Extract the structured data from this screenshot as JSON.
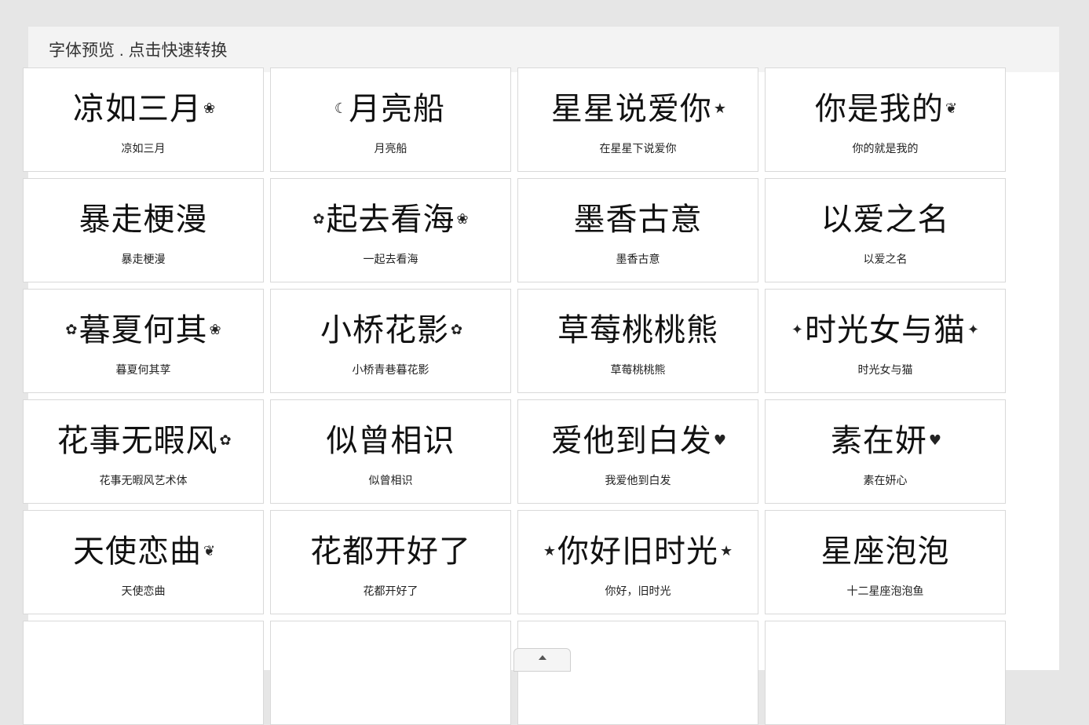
{
  "panel": {
    "title": "字体预览 . 点击快速转换"
  },
  "fonts": [
    {
      "preview": "凉如三月",
      "caption": "凉如三月",
      "deco_left": "",
      "deco_right": "❀"
    },
    {
      "preview": "月亮船",
      "caption": "月亮船",
      "deco_left": "☾",
      "deco_right": ""
    },
    {
      "preview": "星星说爱你",
      "caption": "在星星下说爱你",
      "deco_left": "",
      "deco_right": "★"
    },
    {
      "preview": "你是我的",
      "caption": "你的就是我的",
      "deco_left": "",
      "deco_right": "❦"
    },
    {
      "preview": "暴走梗漫",
      "caption": "暴走梗漫",
      "deco_left": "",
      "deco_right": ""
    },
    {
      "preview": "起去看海",
      "caption": "一起去看海",
      "deco_left": "✿",
      "deco_right": "❀"
    },
    {
      "preview": "墨香古意",
      "caption": "墨香古意",
      "deco_left": "",
      "deco_right": ""
    },
    {
      "preview": "以爱之名",
      "caption": "以爱之名",
      "deco_left": "",
      "deco_right": ""
    },
    {
      "preview": "暮夏何其",
      "caption": "暮夏何其莩",
      "deco_left": "✿",
      "deco_right": "❀"
    },
    {
      "preview": "小桥花影",
      "caption": "小桥青巷暮花影",
      "deco_left": "",
      "deco_right": "✿"
    },
    {
      "preview": "草莓桃桃熊",
      "caption": "草莓桃桃熊",
      "deco_left": "",
      "deco_right": ""
    },
    {
      "preview": "时光女与猫",
      "caption": "时光女与猫",
      "deco_left": "✦",
      "deco_right": "✦"
    },
    {
      "preview": "花事无暇风",
      "caption": "花事无暇风艺术体",
      "deco_left": "",
      "deco_right": "✿"
    },
    {
      "preview": "似曾相识",
      "caption": "似曾相识",
      "deco_left": "",
      "deco_right": ""
    },
    {
      "preview": "爱他到白发",
      "caption": "我爱他到白发",
      "deco_left": "",
      "deco_right": "♥"
    },
    {
      "preview": "素在妍",
      "caption": "素在妍心",
      "deco_left": "",
      "deco_right": "♥"
    },
    {
      "preview": "天使恋曲",
      "caption": "天使恋曲",
      "deco_left": "",
      "deco_right": "❦"
    },
    {
      "preview": "花都开好了",
      "caption": "花都开好了",
      "deco_left": "",
      "deco_right": ""
    },
    {
      "preview": "你好旧时光",
      "caption": "你好，旧时光",
      "deco_left": "★",
      "deco_right": "★"
    },
    {
      "preview": "星座泡泡",
      "caption": "十二星座泡泡鱼",
      "deco_left": "",
      "deco_right": ""
    },
    {
      "preview": "",
      "caption": "",
      "deco_left": "",
      "deco_right": ""
    },
    {
      "preview": "",
      "caption": "",
      "deco_left": "",
      "deco_right": ""
    },
    {
      "preview": "",
      "caption": "",
      "deco_left": "",
      "deco_right": ""
    },
    {
      "preview": "",
      "caption": "",
      "deco_left": "",
      "deco_right": ""
    }
  ],
  "scroll_top": {
    "icon": "chevron-up-icon"
  }
}
